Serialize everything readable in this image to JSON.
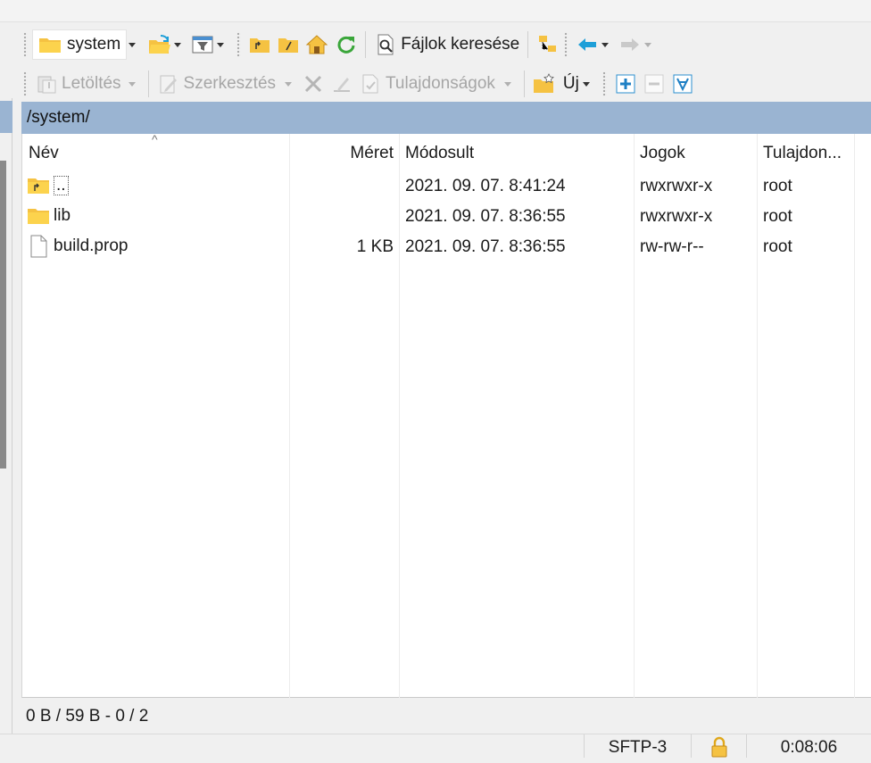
{
  "toolbar1": {
    "drive_label": "system",
    "find_files_label": "Fájlok keresése"
  },
  "toolbar2": {
    "download_label": "Letöltés",
    "edit_label": "Szerkesztés",
    "properties_label": "Tulajdonságok",
    "new_label": "Új"
  },
  "path": "/system/",
  "columns": {
    "name": "Név",
    "size": "Méret",
    "modified": "Módosult",
    "rights": "Jogok",
    "owner": "Tulajdon..."
  },
  "files": [
    {
      "name": "..",
      "size": "",
      "modified": "2021. 09. 07. 8:41:24",
      "rights": "rwxrwxr-x",
      "owner": "root",
      "icon": "parent-folder-icon"
    },
    {
      "name": "lib",
      "size": "",
      "modified": "2021. 09. 07. 8:36:55",
      "rights": "rwxrwxr-x",
      "owner": "root",
      "icon": "folder-icon"
    },
    {
      "name": "build.prop",
      "size": "1 KB",
      "modified": "2021. 09. 07. 8:36:55",
      "rights": "rw-rw-r--",
      "owner": "root",
      "icon": "file-icon"
    }
  ],
  "status": {
    "selection": "0 B / 59 B - 0 / 2",
    "protocol": "SFTP-3",
    "elapsed": "0:08:06"
  },
  "colors": {
    "path_bar": "#9ab4d2",
    "folder_yellow": "#f5c242",
    "accent_blue": "#1e9fd8",
    "refresh_green": "#3aa63a"
  }
}
